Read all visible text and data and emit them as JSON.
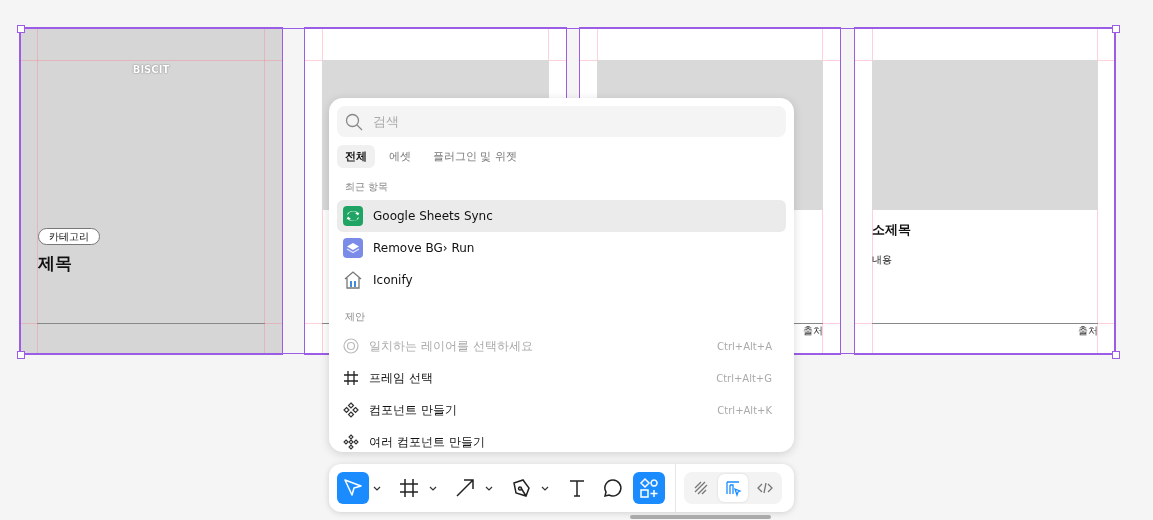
{
  "frames": [
    {
      "kind": "cover",
      "brand": "BISCIT",
      "category": "카테고리",
      "title": "제목"
    },
    {
      "kind": "card"
    },
    {
      "kind": "card",
      "source": "출처"
    },
    {
      "kind": "card",
      "subtitle": "소제목",
      "body": "내용",
      "source": "출처"
    }
  ],
  "search": {
    "placeholder": "검색"
  },
  "tabs": [
    {
      "label": "전체",
      "selected": true
    },
    {
      "label": "에셋",
      "selected": false
    },
    {
      "label": "플러그인 및 위젯",
      "selected": false
    }
  ],
  "recent": {
    "heading": "최근 항목",
    "items": [
      {
        "label": "Google Sheets Sync",
        "kind": "sync",
        "selected": true
      },
      {
        "label": "Remove BG› Run",
        "kind": "layers",
        "selected": false
      },
      {
        "label": "Iconify",
        "kind": "house",
        "selected": false
      }
    ]
  },
  "suggestions": {
    "heading": "제안",
    "items": [
      {
        "label": "일치하는 레이어를 선택하세요",
        "shortcut": "Ctrl+Alt+A",
        "kind": "target",
        "disabled": true
      },
      {
        "label": "프레임 선택",
        "shortcut": "Ctrl+Alt+G",
        "kind": "frame",
        "disabled": false
      },
      {
        "label": "컴포넌트 만들기",
        "shortcut": "Ctrl+Alt+K",
        "kind": "component",
        "disabled": false
      },
      {
        "label": "여러 컴포넌트 만들기",
        "kind": "components",
        "disabled": false
      }
    ]
  },
  "toolbar": {
    "tools": [
      {
        "kind": "move",
        "selected": true
      },
      {
        "kind": "frame",
        "selected": false
      },
      {
        "kind": "arrow",
        "selected": false
      },
      {
        "kind": "pen",
        "selected": false
      },
      {
        "kind": "text",
        "selected": false
      },
      {
        "kind": "comment",
        "selected": false
      },
      {
        "kind": "actions",
        "selected": true
      }
    ],
    "modes": [
      {
        "kind": "draw",
        "selected": false
      },
      {
        "kind": "design",
        "selected": true
      },
      {
        "kind": "code",
        "selected": false
      }
    ]
  }
}
